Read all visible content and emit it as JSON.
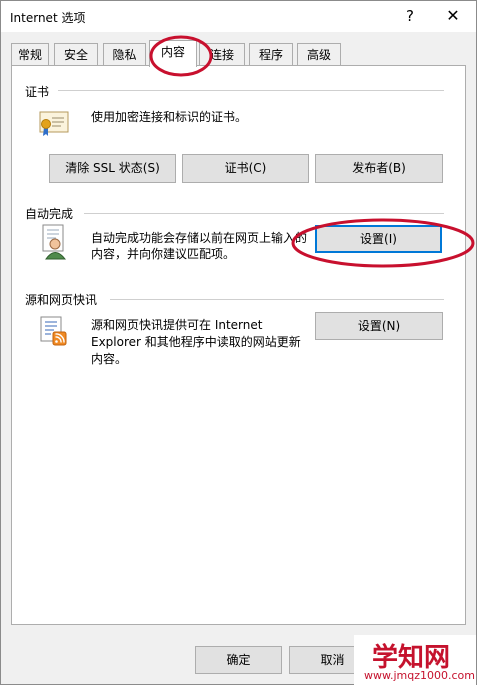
{
  "window": {
    "title": "Internet 选项",
    "help_glyph": "?",
    "close_glyph": "✕"
  },
  "tabs": [
    {
      "label": "常规"
    },
    {
      "label": "安全"
    },
    {
      "label": "隐私"
    },
    {
      "label": "内容",
      "active": true
    },
    {
      "label": "连接"
    },
    {
      "label": "程序"
    },
    {
      "label": "高级"
    }
  ],
  "certificates": {
    "title": "证书",
    "description": "使用加密连接和标识的证书。",
    "icon": "certificate-icon",
    "clear_ssl_button": "清除 SSL 状态(S)",
    "certificates_button": "证书(C)",
    "publishers_button": "发布者(B)"
  },
  "autocomplete": {
    "title": "自动完成",
    "description_line1": "自动完成功能会存储以前在网页上输入的",
    "description_line2": "内容，并向你建议匹配项。",
    "icon": "autocomplete-icon",
    "settings_button": "设置(I)"
  },
  "feeds": {
    "title": "源和网页快讯",
    "description_line1": "源和网页快讯提供可在 Internet",
    "description_line2": "Explorer 和其他程序中读取的网站更新",
    "description_line3": "内容。",
    "icon": "rss-feed-icon",
    "settings_button": "设置(N)"
  },
  "footer": {
    "ok_button": "确定",
    "cancel_button": "取消"
  },
  "watermark": {
    "main": "学知网",
    "url": "www.jmqz1000.com"
  },
  "colors": {
    "annotation_red": "#c8102e",
    "focus_blue": "#0078d7"
  }
}
